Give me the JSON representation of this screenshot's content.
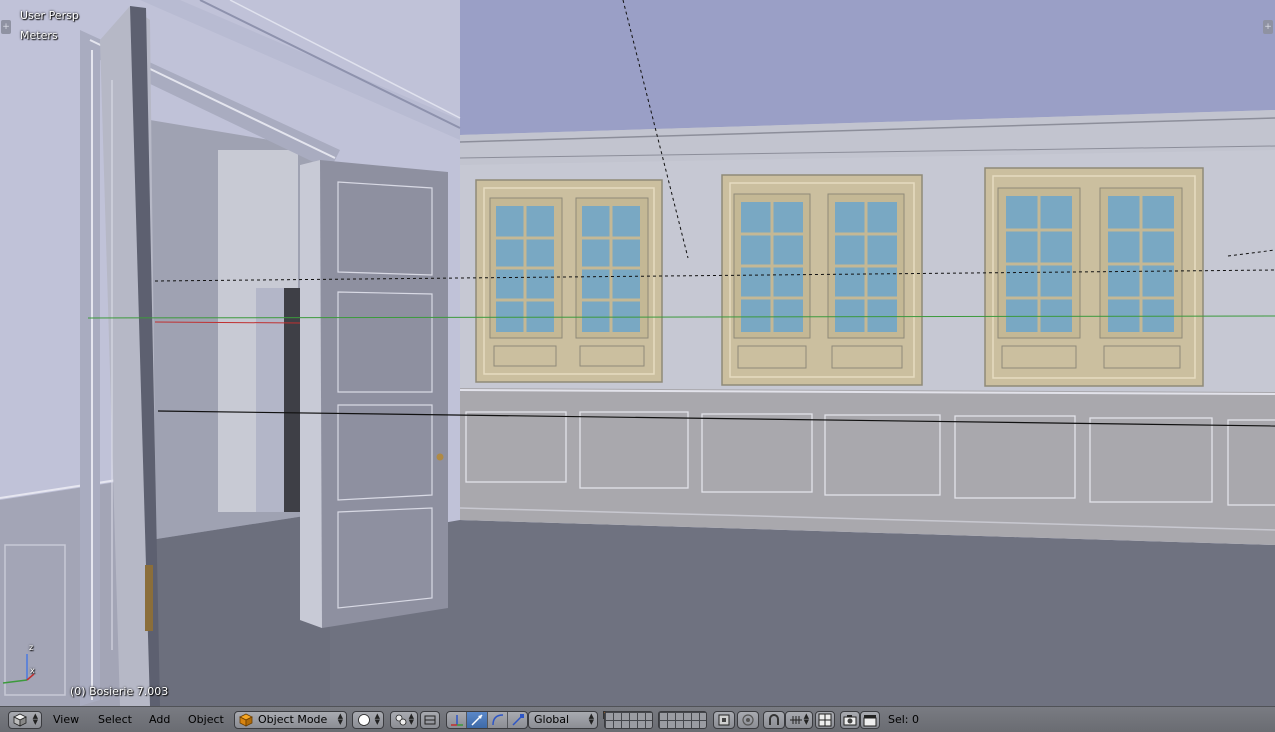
{
  "viewport": {
    "view_name": "User Persp",
    "units": "Meters",
    "object_info": "(0) Bosierie 7.003",
    "axis_labels": {
      "x": "x",
      "z": "z"
    }
  },
  "header": {
    "editor_type_icon": "3d-view-cube-icon",
    "menus": [
      "View",
      "Select",
      "Add",
      "Object"
    ],
    "mode": "Object Mode",
    "shading_icon": "solid-sphere-icon",
    "pivot_icon": "pivot-point-icon",
    "orientation": "Global",
    "selection_status": "Sel: 0"
  },
  "colors": {
    "ceiling": "#9a9fc6",
    "wall": "#c5c7d6",
    "wainscot": "#a4a4ac",
    "floor": "#6f7280",
    "door": "#8d8f9f",
    "window_frame": "#c9bb9a",
    "glass": "#79a8c3",
    "x_axis": "#c03030",
    "y_axis": "#3c9a3c",
    "active_blue": "#4a78b8"
  }
}
